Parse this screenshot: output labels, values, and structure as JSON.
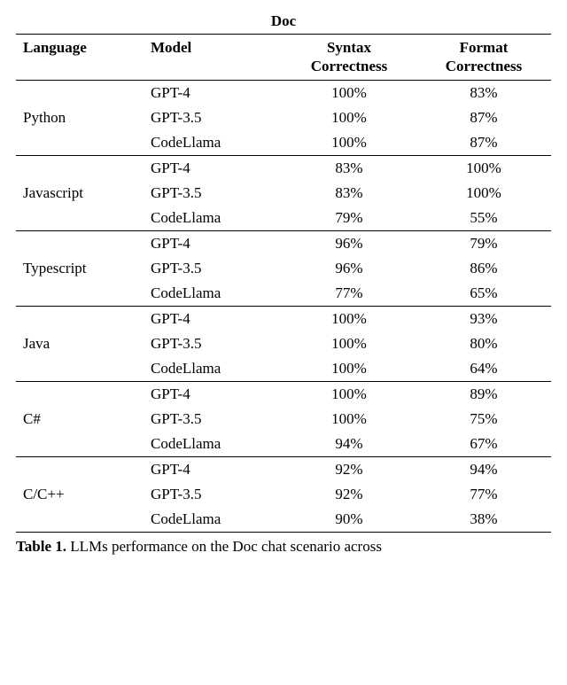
{
  "table": {
    "title": "Doc",
    "columns": {
      "language": "Language",
      "model": "Model",
      "syntax_line1": "Syntax",
      "syntax_line2": "Correctness",
      "format_line1": "Format",
      "format_line2": "Correctness"
    },
    "groups": [
      {
        "language": "Python",
        "rows": [
          {
            "model": "GPT-4",
            "syntax": "100%",
            "format": "83%"
          },
          {
            "model": "GPT-3.5",
            "syntax": "100%",
            "format": "87%"
          },
          {
            "model": "CodeLlama",
            "syntax": "100%",
            "format": "87%"
          }
        ]
      },
      {
        "language": "Javascript",
        "rows": [
          {
            "model": "GPT-4",
            "syntax": "83%",
            "format": "100%"
          },
          {
            "model": "GPT-3.5",
            "syntax": "83%",
            "format": "100%"
          },
          {
            "model": "CodeLlama",
            "syntax": "79%",
            "format": "55%"
          }
        ]
      },
      {
        "language": "Typescript",
        "rows": [
          {
            "model": "GPT-4",
            "syntax": "96%",
            "format": "79%"
          },
          {
            "model": "GPT-3.5",
            "syntax": "96%",
            "format": "86%"
          },
          {
            "model": "CodeLlama",
            "syntax": "77%",
            "format": "65%"
          }
        ]
      },
      {
        "language": "Java",
        "rows": [
          {
            "model": "GPT-4",
            "syntax": "100%",
            "format": "93%"
          },
          {
            "model": "GPT-3.5",
            "syntax": "100%",
            "format": "80%"
          },
          {
            "model": "CodeLlama",
            "syntax": "100%",
            "format": "64%"
          }
        ]
      },
      {
        "language": "C#",
        "rows": [
          {
            "model": "GPT-4",
            "syntax": "100%",
            "format": "89%"
          },
          {
            "model": "GPT-3.5",
            "syntax": "100%",
            "format": "75%"
          },
          {
            "model": "CodeLlama",
            "syntax": "94%",
            "format": "67%"
          }
        ]
      },
      {
        "language": "C/C++",
        "rows": [
          {
            "model": "GPT-4",
            "syntax": "92%",
            "format": "94%"
          },
          {
            "model": "GPT-3.5",
            "syntax": "92%",
            "format": "77%"
          },
          {
            "model": "CodeLlama",
            "syntax": "90%",
            "format": "38%"
          }
        ]
      }
    ]
  },
  "caption": {
    "label": "Table 1.",
    "text": " LLMs performance on the Doc chat scenario across"
  }
}
